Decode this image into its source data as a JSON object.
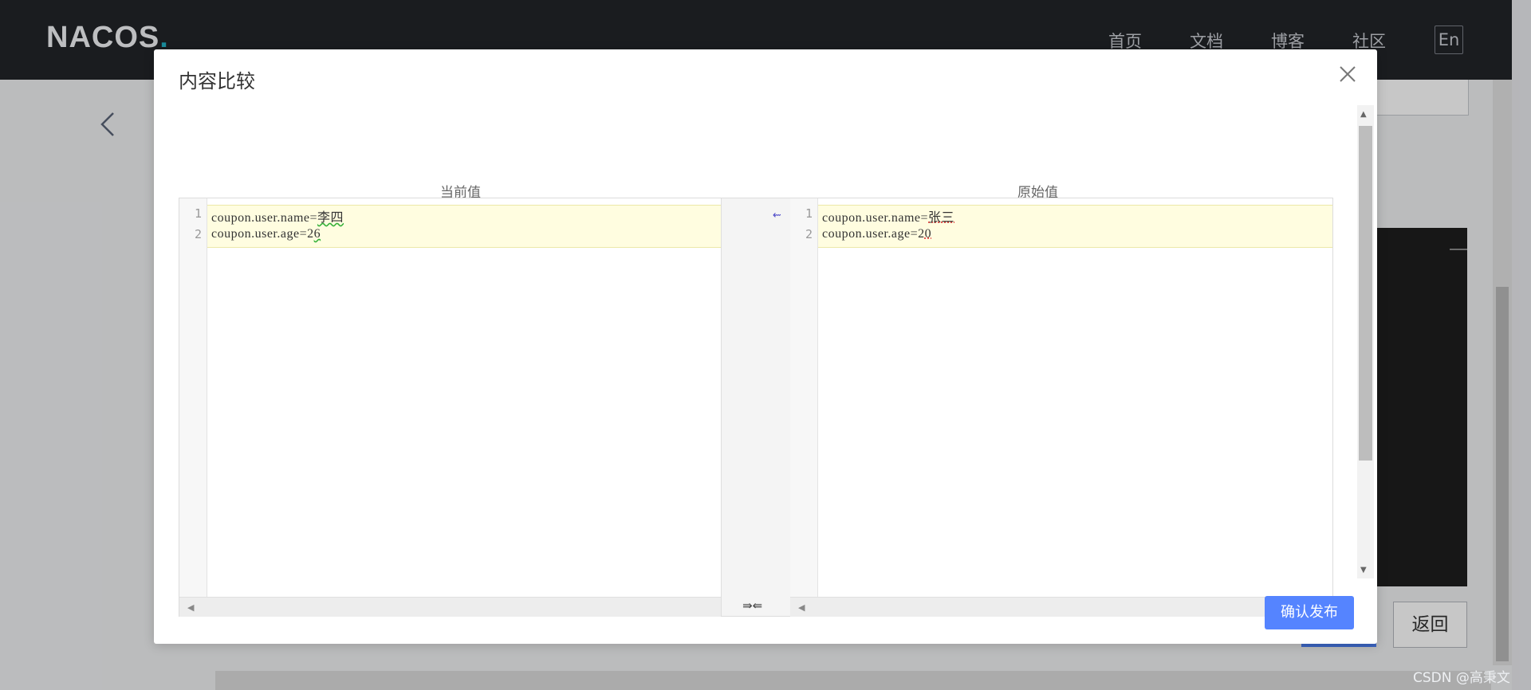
{
  "app": {
    "logo": "NACOS",
    "logo_dot": ".",
    "nav": [
      "首页",
      "文档",
      "博客",
      "社区"
    ],
    "lang_button": "En"
  },
  "background": {
    "back_button": "返回"
  },
  "dialog": {
    "title": "内容比较",
    "left_label": "当前值",
    "right_label": "原始值",
    "left_lines": [
      {
        "num": "1",
        "prefix": "coupon.user.name=",
        "changed": "李四"
      },
      {
        "num": "2",
        "prefix": "coupon.user.age=2",
        "changed": "6"
      }
    ],
    "right_lines": [
      {
        "num": "1",
        "prefix": "coupon.user.name=",
        "changed": "张三"
      },
      {
        "num": "2",
        "prefix": "coupon.user.age=2",
        "changed": "0"
      }
    ],
    "merge_arrow": "⇜",
    "merge_all": "⇛⇚",
    "confirm_button": "确认发布"
  },
  "watermark": "CSDN @高秉文",
  "colors": {
    "primary": "#5584ff",
    "topbar": "#222428",
    "changed_line_bg": "#fffde0"
  }
}
